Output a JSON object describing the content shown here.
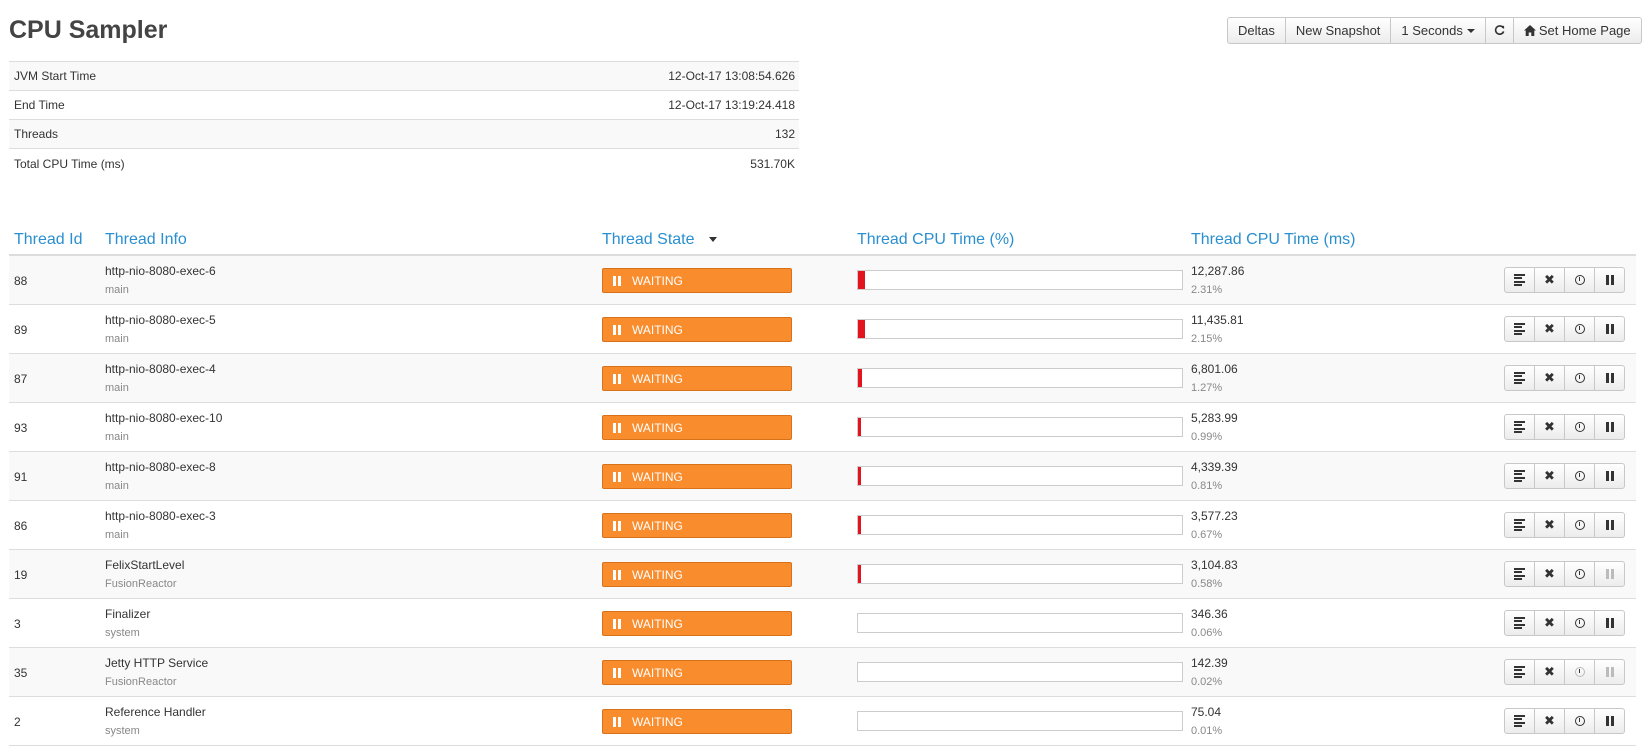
{
  "page": {
    "title": "CPU Sampler"
  },
  "toolbar": {
    "deltas": "Deltas",
    "new_snapshot": "New Snapshot",
    "interval": "1 Seconds",
    "refresh_icon": "refresh-icon",
    "home_icon": "home-icon",
    "set_home_page": "Set Home Page"
  },
  "summary": [
    {
      "label": "JVM Start Time",
      "value": "12-Oct-17 13:08:54.626"
    },
    {
      "label": "End Time",
      "value": "12-Oct-17 13:19:24.418"
    },
    {
      "label": "Threads",
      "value": "132"
    },
    {
      "label": "Total CPU Time (ms)",
      "value": "531.70K"
    }
  ],
  "columns": {
    "thread_id": "Thread Id",
    "thread_info": "Thread Info",
    "thread_state": "Thread State",
    "cpu_pct": "Thread CPU Time (%)",
    "cpu_ms": "Thread CPU Time (ms)"
  },
  "colors": {
    "accent": "#2a8fcf",
    "waiting": "#f98c2d",
    "cpu_bar": "#e3141e"
  },
  "threads": [
    {
      "id": "88",
      "name": "http-nio-8080-exec-6",
      "group": "main",
      "state": "WAITING",
      "cpu_ms": "12,287.86",
      "cpu_pct": "2.31%",
      "pct_value": 2.31,
      "pause_enabled": true
    },
    {
      "id": "89",
      "name": "http-nio-8080-exec-5",
      "group": "main",
      "state": "WAITING",
      "cpu_ms": "11,435.81",
      "cpu_pct": "2.15%",
      "pct_value": 2.15,
      "pause_enabled": true
    },
    {
      "id": "87",
      "name": "http-nio-8080-exec-4",
      "group": "main",
      "state": "WAITING",
      "cpu_ms": "6,801.06",
      "cpu_pct": "1.27%",
      "pct_value": 1.27,
      "pause_enabled": true
    },
    {
      "id": "93",
      "name": "http-nio-8080-exec-10",
      "group": "main",
      "state": "WAITING",
      "cpu_ms": "5,283.99",
      "cpu_pct": "0.99%",
      "pct_value": 0.99,
      "pause_enabled": true
    },
    {
      "id": "91",
      "name": "http-nio-8080-exec-8",
      "group": "main",
      "state": "WAITING",
      "cpu_ms": "4,339.39",
      "cpu_pct": "0.81%",
      "pct_value": 0.81,
      "pause_enabled": true
    },
    {
      "id": "86",
      "name": "http-nio-8080-exec-3",
      "group": "main",
      "state": "WAITING",
      "cpu_ms": "3,577.23",
      "cpu_pct": "0.67%",
      "pct_value": 0.67,
      "pause_enabled": true
    },
    {
      "id": "19",
      "name": "FelixStartLevel",
      "group": "FusionReactor",
      "state": "WAITING",
      "cpu_ms": "3,104.83",
      "cpu_pct": "0.58%",
      "pct_value": 0.58,
      "pause_enabled": false
    },
    {
      "id": "3",
      "name": "Finalizer",
      "group": "system",
      "state": "WAITING",
      "cpu_ms": "346.36",
      "cpu_pct": "0.06%",
      "pct_value": 0.06,
      "pause_enabled": true
    },
    {
      "id": "35",
      "name": "Jetty HTTP Service",
      "group": "FusionReactor",
      "state": "WAITING",
      "cpu_ms": "142.39",
      "cpu_pct": "0.02%",
      "pct_value": 0.02,
      "pause_enabled": false,
      "clock_enabled": false
    },
    {
      "id": "2",
      "name": "Reference Handler",
      "group": "system",
      "state": "WAITING",
      "cpu_ms": "75.04",
      "cpu_pct": "0.01%",
      "pct_value": 0.01,
      "pause_enabled": true
    }
  ]
}
